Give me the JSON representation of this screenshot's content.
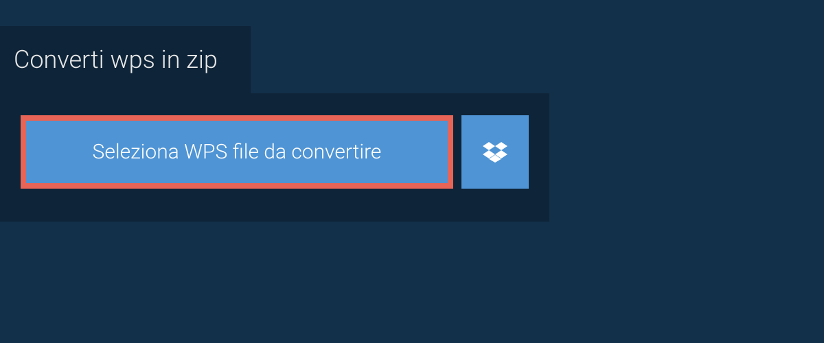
{
  "tab": {
    "title": "Converti wps in zip"
  },
  "actions": {
    "select_file_label": "Seleziona WPS file da convertire"
  }
}
